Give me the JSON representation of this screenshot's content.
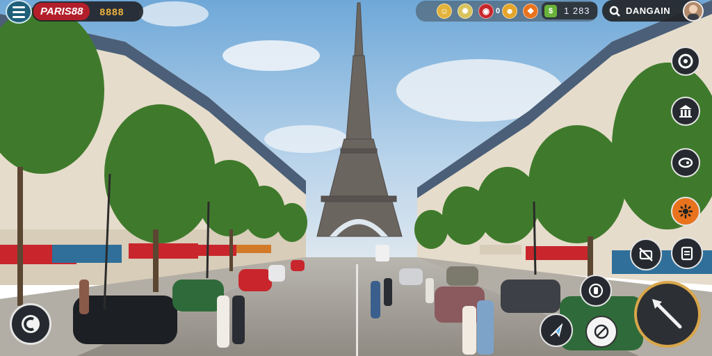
{
  "hud": {
    "city_name": "PARIS88",
    "city_score": "8888",
    "resources": [
      {
        "name": "gold-coin",
        "value": ""
      },
      {
        "name": "gear-token",
        "value": ""
      },
      {
        "name": "red-gem",
        "value": "0"
      },
      {
        "name": "yellow-coin",
        "value": ""
      },
      {
        "name": "orange-badge",
        "value": ""
      }
    ],
    "cash_value": "1 283",
    "search_label": "DANGAIN"
  },
  "right_buttons": [
    {
      "icon": "camera-icon"
    },
    {
      "icon": "temple-icon"
    },
    {
      "icon": "swipe-icon"
    },
    {
      "icon": "burst-icon"
    },
    {
      "icon": "no-camera-icon"
    },
    {
      "icon": "map-icon"
    }
  ],
  "bottom_buttons": [
    {
      "icon": "target-icon"
    },
    {
      "icon": "arrow-icon"
    },
    {
      "icon": "skill-icon"
    },
    {
      "icon": "spear-icon"
    }
  ],
  "colors": {
    "city_pill": "#b21f2a",
    "score": "#f2b43c",
    "attack_ring": "#d8a64a",
    "orange_button": "#e8731c"
  }
}
